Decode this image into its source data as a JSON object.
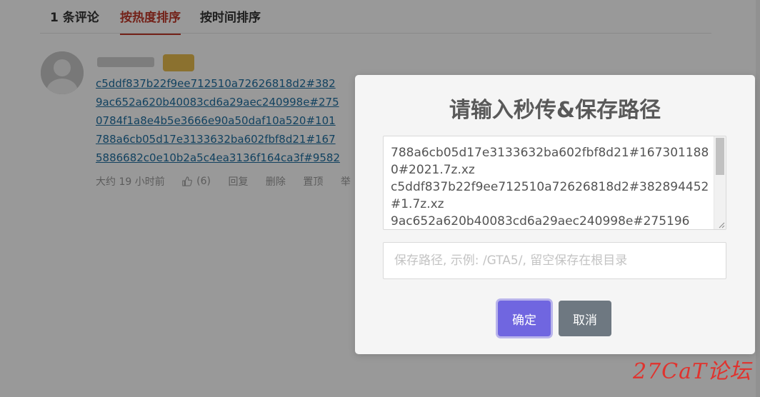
{
  "tabs": {
    "count": "1 条评论",
    "hot": "按热度排序",
    "time": "按时间排序"
  },
  "comment": {
    "links": [
      "c5ddf837b22f9ee712510a72626818d2#382",
      "9ac652a620b40083cd6a29aec240998e#275",
      "0784f1a8e4b5e3666e90a50daf10a520#101",
      "788a6cb05d17e3133632ba602fbf8d21#167",
      "5886682c0e10b2a5c4ea3136f164ca3f#9582"
    ],
    "time": "大约 19 小时前",
    "likes": "(6)",
    "reply": "回复",
    "delete": "删除",
    "pin": "置顶",
    "report": "举"
  },
  "modal": {
    "title": "请输入秒传&保存路径",
    "textarea_value": "788a6cb05d17e3133632ba602fbf8d21#1673011880#2021.7z.xz\nc5ddf837b22f9ee712510a72626818d2#382894452#1.7z.xz\n9ac652a620b40083cd6a29aec240998e#275196",
    "path_placeholder": "保存路径, 示例: /GTA5/, 留空保存在根目录",
    "path_value": "",
    "confirm": "确定",
    "cancel": "取消"
  },
  "watermark": "27CaT论坛",
  "colors": {
    "accent_tab": "#c0392b",
    "link": "#1f6ea0",
    "confirm_button": "#7066e0",
    "cancel_button": "#6e7881",
    "watermark": "#e0332e"
  }
}
